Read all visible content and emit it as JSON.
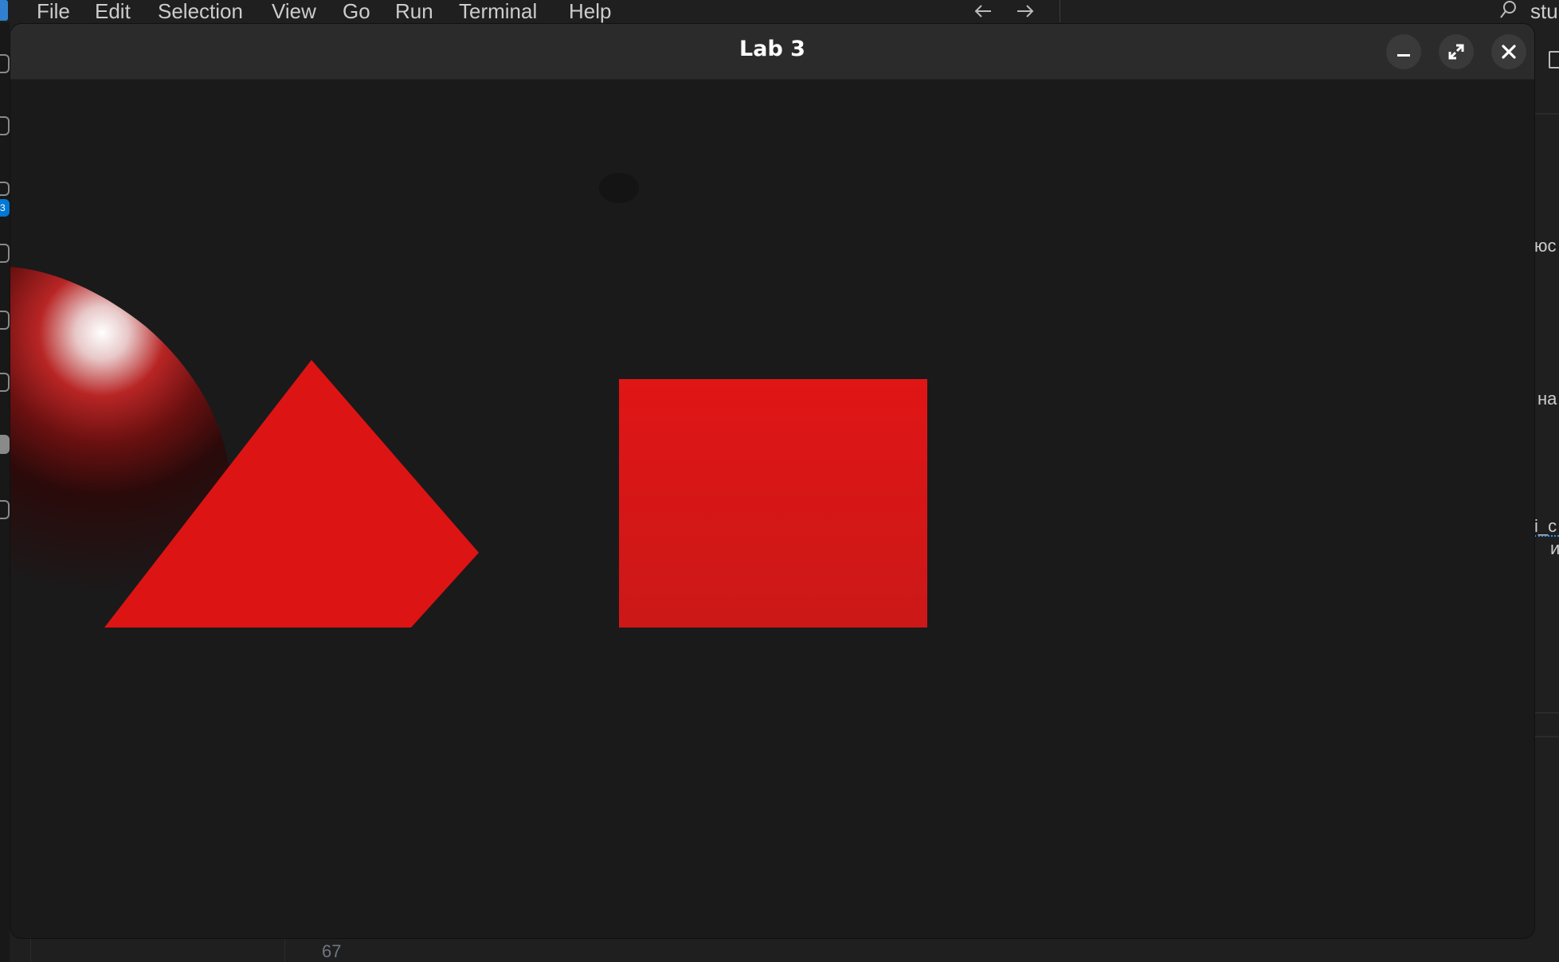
{
  "menubar": {
    "items": [
      "File",
      "Edit",
      "Selection",
      "View",
      "Go",
      "Run",
      "Terminal",
      "Help"
    ],
    "nav_back_icon": "arrow-left-icon",
    "nav_forward_icon": "arrow-right-icon",
    "search_icon": "search-icon",
    "command_center_text": "stu"
  },
  "activity_bar": {
    "badge_count": "3"
  },
  "editor": {
    "line_number": "67",
    "right_fragments": [
      "юс",
      "на",
      "і_с",
      "и"
    ]
  },
  "lab_window": {
    "title": "Lab 3",
    "minimize_icon": "minimize-icon",
    "maximize_icon": "maximize-icon",
    "close_icon": "close-icon"
  },
  "scene": {
    "background_color": "#1a1a1b",
    "shape_color": "#dc1414",
    "shapes": [
      "sphere",
      "triangle",
      "rectangle",
      "dot"
    ]
  }
}
